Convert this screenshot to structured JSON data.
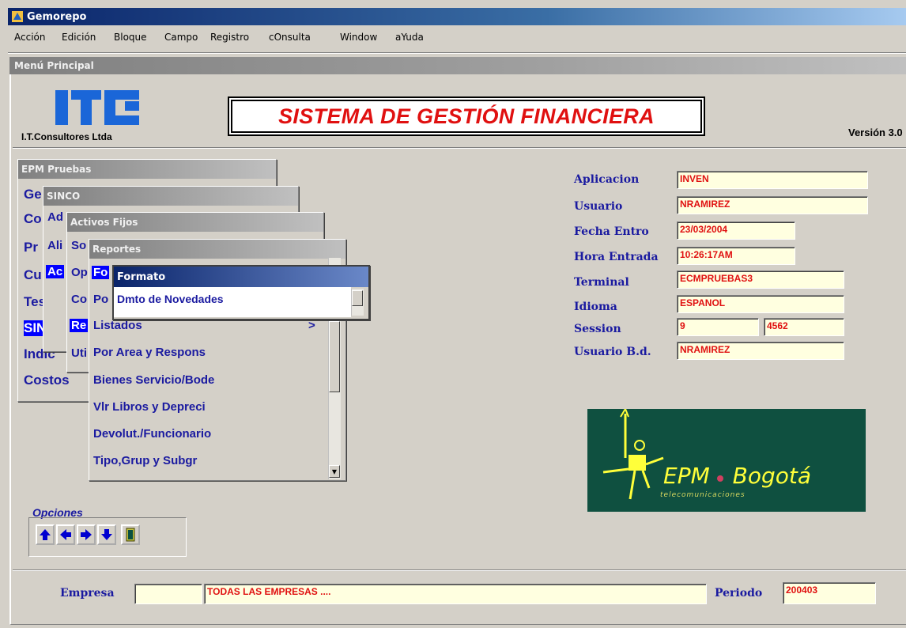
{
  "window": {
    "title": "Gemorepo"
  },
  "menubar": [
    "Acción",
    "Edición",
    "Bloque",
    "Campo",
    "Registro",
    "cOnsulta",
    "Window",
    "aYuda"
  ],
  "inner_window": {
    "title": "Menú Principal"
  },
  "header": {
    "logo_caption": "I.T.Consultores Ltda",
    "system_title": "SISTEMA DE GESTIÓN FINANCIERA",
    "version": "Versión 3.0"
  },
  "panels": {
    "p1": {
      "title": "EPM Pruebas",
      "items": [
        "Ge",
        "Co",
        "Pr",
        "Cu",
        "Teso",
        "SINC",
        "Indic",
        "Costos"
      ]
    },
    "p2": {
      "title": "SINCO",
      "items": [
        "Ad",
        "Ali",
        "Ac"
      ]
    },
    "p3": {
      "title": "Activos Fijos",
      "items": [
        "So",
        "Op",
        "Co",
        "Re",
        "Uti"
      ]
    },
    "p4": {
      "title": "Reportes",
      "items": [
        "Fo",
        "Po",
        "Listados",
        "Por Area y Respons",
        "Bienes Servicio/Bode",
        "Vlr Libros y Depreci",
        "Devolut./Funcionario",
        "Tipo,Grup y Subgr"
      ],
      "submenu_arrow": ">"
    },
    "p5": {
      "title": "Formato",
      "items": [
        "Dmto de Novedades"
      ]
    }
  },
  "info": {
    "aplicacion": {
      "label": "Aplicacion",
      "value": "INVEN"
    },
    "usuario": {
      "label": "Usuario",
      "value": "NRAMIREZ"
    },
    "fecha_entro": {
      "label": "Fecha Entro",
      "value": "23/03/2004"
    },
    "hora_entrada": {
      "label": "Hora Entrada",
      "value": "10:26:17AM"
    },
    "terminal": {
      "label": "Terminal",
      "value": "ECMPRUEBAS3"
    },
    "idioma": {
      "label": "Idioma",
      "value": "ESPANOL"
    },
    "session": {
      "label": "Session",
      "value": "9",
      "value2": "4562"
    },
    "usuario_bd": {
      "label": "Usuario B.d.",
      "value": "NRAMIREZ"
    }
  },
  "epm_logo": {
    "name": "EPM",
    "city": "Bogotá",
    "subtitle": "telecomunicaciones"
  },
  "options": {
    "label": "Opciones"
  },
  "footer": {
    "empresa_label": "Empresa",
    "empresa_code": "",
    "empresa_name": "TODAS LAS EMPRESAS ....",
    "periodo_label": "Periodo",
    "periodo_value": "200403"
  },
  "colors": {
    "accent_blue": "#1a1aa0",
    "value_red": "#e01010",
    "field_bg": "#ffffe0",
    "epm_green": "#0f5040"
  }
}
